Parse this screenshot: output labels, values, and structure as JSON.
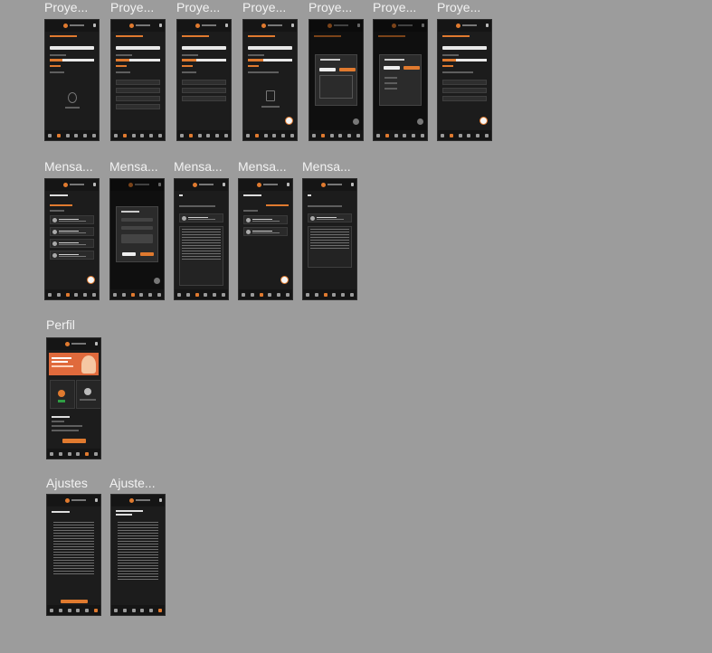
{
  "canvas": {
    "background": "#9c9c9c",
    "accent": "#e07a2f",
    "frame_bg": "#1c1c1c"
  },
  "labels": {
    "p1": "Proye...",
    "p2": "Proye...",
    "p3": "Proye...",
    "p4": "Proye...",
    "p5": "Proye...",
    "p6": "Proye...",
    "p7": "Proye...",
    "m1": "Mensa...",
    "m2": "Mensa...",
    "m3": "Mensa...",
    "m4": "Mensa...",
    "m5": "Mensa...",
    "perfil": "Perfil",
    "a1": "Ajustes",
    "a2": "Ajuste..."
  },
  "frames": {
    "section_title": "Proyecto Vilnius",
    "messages_title": "Mensajería",
    "security_title": "Seguridad",
    "terms_title": "Términos y Condiciones de Uso",
    "welcome_title": "Bienvenido a Diligence Tech"
  },
  "nav_icons": [
    "home-icon",
    "project-icon",
    "message-icon",
    "chart-icon",
    "profile-icon",
    "settings-icon"
  ]
}
